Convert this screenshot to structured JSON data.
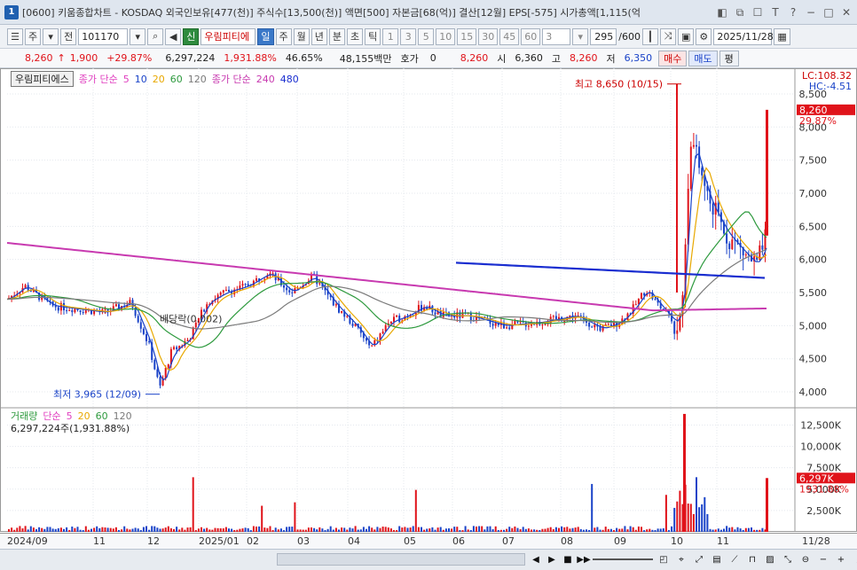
{
  "window": {
    "badge": "1",
    "title": "[0600] 키움종합차트 - KOSDAQ 외국인보유[477(천)] 주식수[13,500(천)] 액면[500] 자본금[68(억)] 결산[12월] EPS[-575] 시가총액[1,115(억"
  },
  "toolbar": {
    "period_main": "주",
    "prev_label": "전",
    "code": "101170",
    "stock_name": "우림피티에",
    "stock_tag": "신",
    "periods": [
      "일",
      "주",
      "월",
      "년",
      "분",
      "초",
      "틱"
    ],
    "active_period": "일",
    "minute_options": [
      "1",
      "3",
      "5",
      "10",
      "15",
      "30",
      "45",
      "60"
    ],
    "custom_value": "3",
    "count": "295",
    "count_total": "/600",
    "date": "2025/11/28"
  },
  "quote": {
    "price": "8,260",
    "arrow": "↑",
    "change": "1,900",
    "change_pct": "+29.87%",
    "volume": "6,297,224",
    "vol_ratio": "1,931.88%",
    "turnover": "46.65%",
    "amount": "48,155백만",
    "hoga_label": "호가",
    "hoga_value": "0",
    "hoga_price": "8,260",
    "open_label": "시",
    "open": "6,360",
    "high_label": "고",
    "high": "8,260",
    "low_label": "저",
    "low": "6,350",
    "buy_label": "매수",
    "sell_label": "매도",
    "eval_label": "평"
  },
  "price_panel": {
    "legend_name": "우림피티에스",
    "legend_ma_title": "종가 단순",
    "ma_periods": [
      "5",
      "10",
      "20",
      "60",
      "120"
    ],
    "legend_ma2_title": "종가 단순",
    "ma2_periods": [
      "240",
      "480"
    ],
    "lc": "LC:108.32",
    "hc": "HC:-4.51",
    "current_price": "8,260",
    "current_pct": "29.87%",
    "high_note": "최고 8,650 (10/15)",
    "low_note": "최저 3,965 (12/09)",
    "dividend_note": "배당락(0.002)",
    "y_ticks": [
      "8,500",
      "8,000",
      "7,500",
      "7,000",
      "6,500",
      "6,000",
      "5,500",
      "5,000",
      "4,500",
      "4,000"
    ]
  },
  "volume_panel": {
    "legend_title": "거래량",
    "legend_ma_title": "단순",
    "ma_periods": [
      "5",
      "20",
      "60",
      "120"
    ],
    "volume_text": "6,297,224주(1,931.88%)",
    "current_volume": "6,297K",
    "current_pct": "1931.88%",
    "y_ticks": [
      "12,500K",
      "10,000K",
      "7,500K",
      "5,000K",
      "2,500K"
    ]
  },
  "x_axis": {
    "labels": [
      "2024/09",
      "11",
      "12",
      "2025/01",
      "02",
      "03",
      "04",
      "05",
      "06",
      "07",
      "08",
      "09",
      "10",
      "11",
      "11/28"
    ]
  },
  "colors": {
    "up": "#e0131a",
    "down": "#1a43c8",
    "ma5": "#e040c0",
    "ma10": "#1a43c8",
    "ma20": "#e8a800",
    "ma60": "#2e9a3e",
    "ma120": "#7a7a7a",
    "ma240": "#c83ab0",
    "ma480": "#1a2ed0"
  },
  "chart_data": {
    "type": "candlestick",
    "x_range": [
      "2024/09",
      "2025/11/28"
    ],
    "ylim": [
      3800,
      8700
    ],
    "price_ticks": [
      4000,
      4500,
      5000,
      5500,
      6000,
      6500,
      7000,
      7500,
      8000,
      8500
    ],
    "high": {
      "value": 8650,
      "date": "10/15"
    },
    "low": {
      "value": 3965,
      "date": "12/09"
    },
    "last": {
      "close": 8260,
      "open": 6360,
      "high": 8260,
      "low": 6350,
      "change_pct": 29.87
    },
    "volume_ylim": [
      0,
      14000
    ],
    "volume_ticks": [
      2500,
      5000,
      7500,
      10000,
      12500
    ],
    "last_volume_k": 6297
  }
}
